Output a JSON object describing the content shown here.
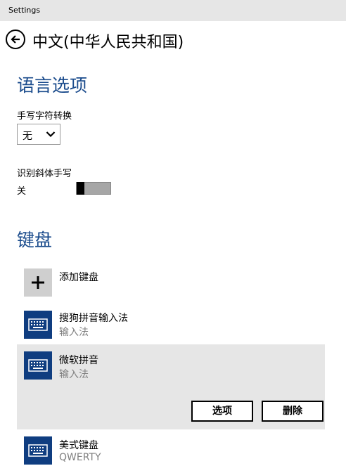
{
  "window": {
    "title": "Settings"
  },
  "header": {
    "title": "中文(中华人民共和国)",
    "back_icon": "back-arrow-circle-icon"
  },
  "language_options": {
    "title": "语言选项",
    "handwriting_conversion": {
      "label": "手写字符转换",
      "value": "无"
    },
    "cursive": {
      "label": "识别斜体手写",
      "state_text": "关",
      "on": false
    }
  },
  "keyboards": {
    "title": "键盘",
    "add_label": "添加键盘",
    "items": [
      {
        "name": "搜狗拼音输入法",
        "sub": "输入法"
      },
      {
        "name": "微软拼音",
        "sub": "输入法",
        "selected": true
      },
      {
        "name": "美式键盘",
        "sub": "QWERTY"
      }
    ],
    "options_button": "选项",
    "remove_button": "删除"
  },
  "colors": {
    "accent": "#1a4b8c",
    "tile": "#0f3d80",
    "selected_bg": "#e6e6e6"
  }
}
